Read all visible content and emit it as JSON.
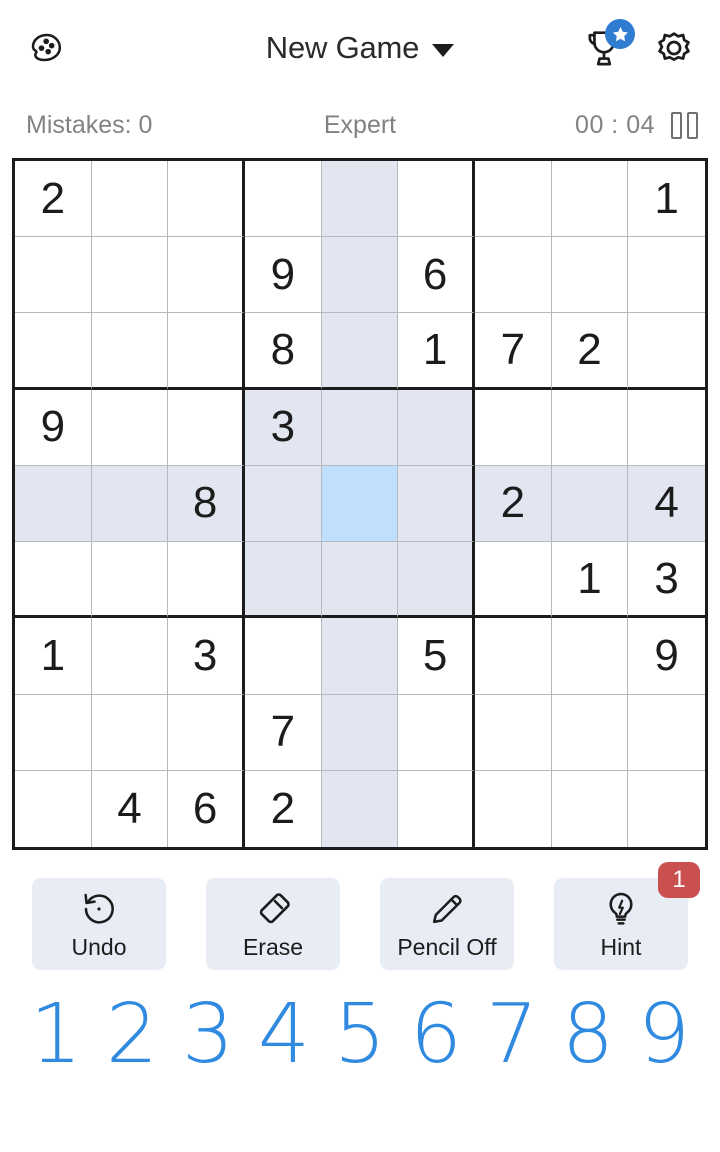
{
  "header": {
    "theme_icon": "palette-icon",
    "title": "New Game",
    "caret_icon": "chevron-down-icon",
    "trophy_icon": "trophy-icon",
    "star_badge_icon": "star-icon",
    "settings_icon": "gear-icon"
  },
  "status": {
    "mistakes": "Mistakes: 0",
    "difficulty": "Expert",
    "timer": "00 : 04",
    "pause_icon": "pause-icon"
  },
  "grid": {
    "rows": [
      [
        "2",
        "",
        "",
        "",
        "",
        "",
        "",
        "",
        "1"
      ],
      [
        "",
        "",
        "",
        "9",
        "",
        "6",
        "",
        "",
        ""
      ],
      [
        "",
        "",
        "",
        "8",
        "",
        "1",
        "7",
        "2",
        ""
      ],
      [
        "9",
        "",
        "",
        "3",
        "",
        "",
        "",
        "",
        ""
      ],
      [
        "",
        "",
        "8",
        "",
        "",
        "",
        "2",
        "",
        "4"
      ],
      [
        "",
        "",
        "",
        "",
        "",
        "",
        "",
        "1",
        "3"
      ],
      [
        "1",
        "",
        "3",
        "",
        "",
        "5",
        "",
        "",
        "9"
      ],
      [
        "",
        "",
        "",
        "7",
        "",
        "",
        "",
        "",
        ""
      ],
      [
        "",
        "4",
        "6",
        "2",
        "",
        "",
        "",
        "",
        ""
      ]
    ],
    "selected": {
      "row": 4,
      "col": 4
    },
    "highlight_row": 4,
    "highlight_col": 4,
    "highlight_box": {
      "row_start": 3,
      "col_start": 3
    },
    "colors": {
      "selected_cell": "#bfdffc",
      "highlight_cell": "#e2e6f0",
      "thick_line": "#1c1c1c",
      "thin_line": "#b6b9bd"
    }
  },
  "actions": [
    {
      "label": "Undo",
      "icon": "undo-icon",
      "badge": null
    },
    {
      "label": "Erase",
      "icon": "eraser-icon",
      "badge": null
    },
    {
      "label": "Pencil Off",
      "icon": "pencil-icon",
      "badge": null
    },
    {
      "label": "Hint",
      "icon": "lightbulb-icon",
      "badge": "1"
    }
  ],
  "numpad": {
    "numbers": [
      "1",
      "2",
      "3",
      "4",
      "5",
      "6",
      "7",
      "8",
      "9"
    ],
    "color": "#2f8ae0"
  }
}
